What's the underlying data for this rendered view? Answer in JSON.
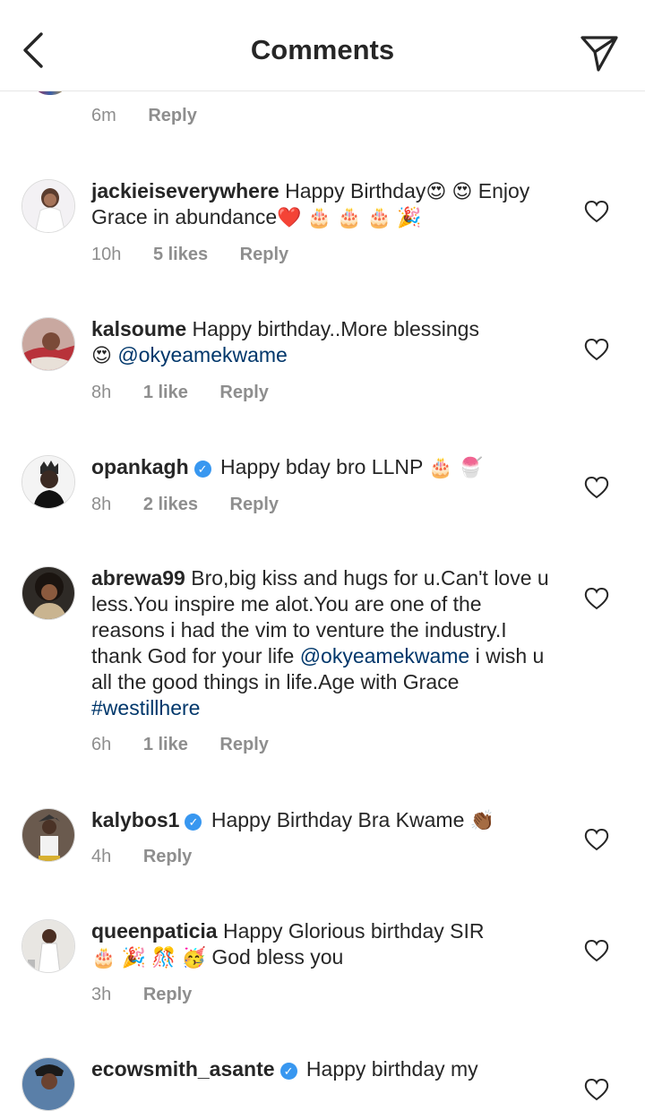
{
  "header": {
    "title": "Comments",
    "back_icon": "chevron-left-icon",
    "send_icon": "paper-plane-icon"
  },
  "top_meta": {
    "time": "6m",
    "reply": "Reply"
  },
  "comments": [
    {
      "username": "jackieiseverywhere",
      "verified": false,
      "text_1": "Happy Birthday",
      "emoji_1": "😍 😍",
      "text_2": "Enjoy Grace in abundance",
      "emoji_2": "❤️ 🎂 🎂 🎂 🎉",
      "time": "10h",
      "likes": "5 likes",
      "reply": "Reply"
    },
    {
      "username": "kalsoume",
      "verified": false,
      "text_1": "Happy birthday..More blessings",
      "emoji_1": "😍",
      "mention": "@okyeamekwame",
      "time": "8h",
      "likes": "1 like",
      "reply": "Reply"
    },
    {
      "username": "opankagh",
      "verified": true,
      "text_1": "Happy bday bro LLNP",
      "emoji_1": "🎂 🍧",
      "time": "8h",
      "likes": "2 likes",
      "reply": "Reply"
    },
    {
      "username": "abrewa99",
      "verified": false,
      "text_1": "Bro,big kiss and hugs for u.Can't love u  less.You inspire me alot.You are one of the reasons i had the vim to venture the industry.I thank God for your life",
      "mention": "@okyeamekwame",
      "text_2": "i wish u all the good things in life.Age with Grace",
      "hashtag": "#westillhere",
      "time": "6h",
      "likes": "1 like",
      "reply": "Reply"
    },
    {
      "username": "kalybos1",
      "verified": true,
      "text_1": "Happy Birthday Bra Kwame",
      "emoji_1": "👏🏾",
      "time": "4h",
      "reply": "Reply"
    },
    {
      "username": "queenpaticia",
      "verified": false,
      "text_1": "Happy Glorious birthday SIR",
      "emoji_1": "🎂 🎉 🎊 🥳",
      "text_2": "God bless you",
      "time": "3h",
      "reply": "Reply"
    },
    {
      "username": "ecowsmith_asante",
      "verified": true,
      "text_1": "Happy birthday my"
    }
  ],
  "colors": {
    "link": "#00376b",
    "meta": "#8e8e8e",
    "verified": "#3897f0",
    "divider": "#e6e6e6"
  }
}
